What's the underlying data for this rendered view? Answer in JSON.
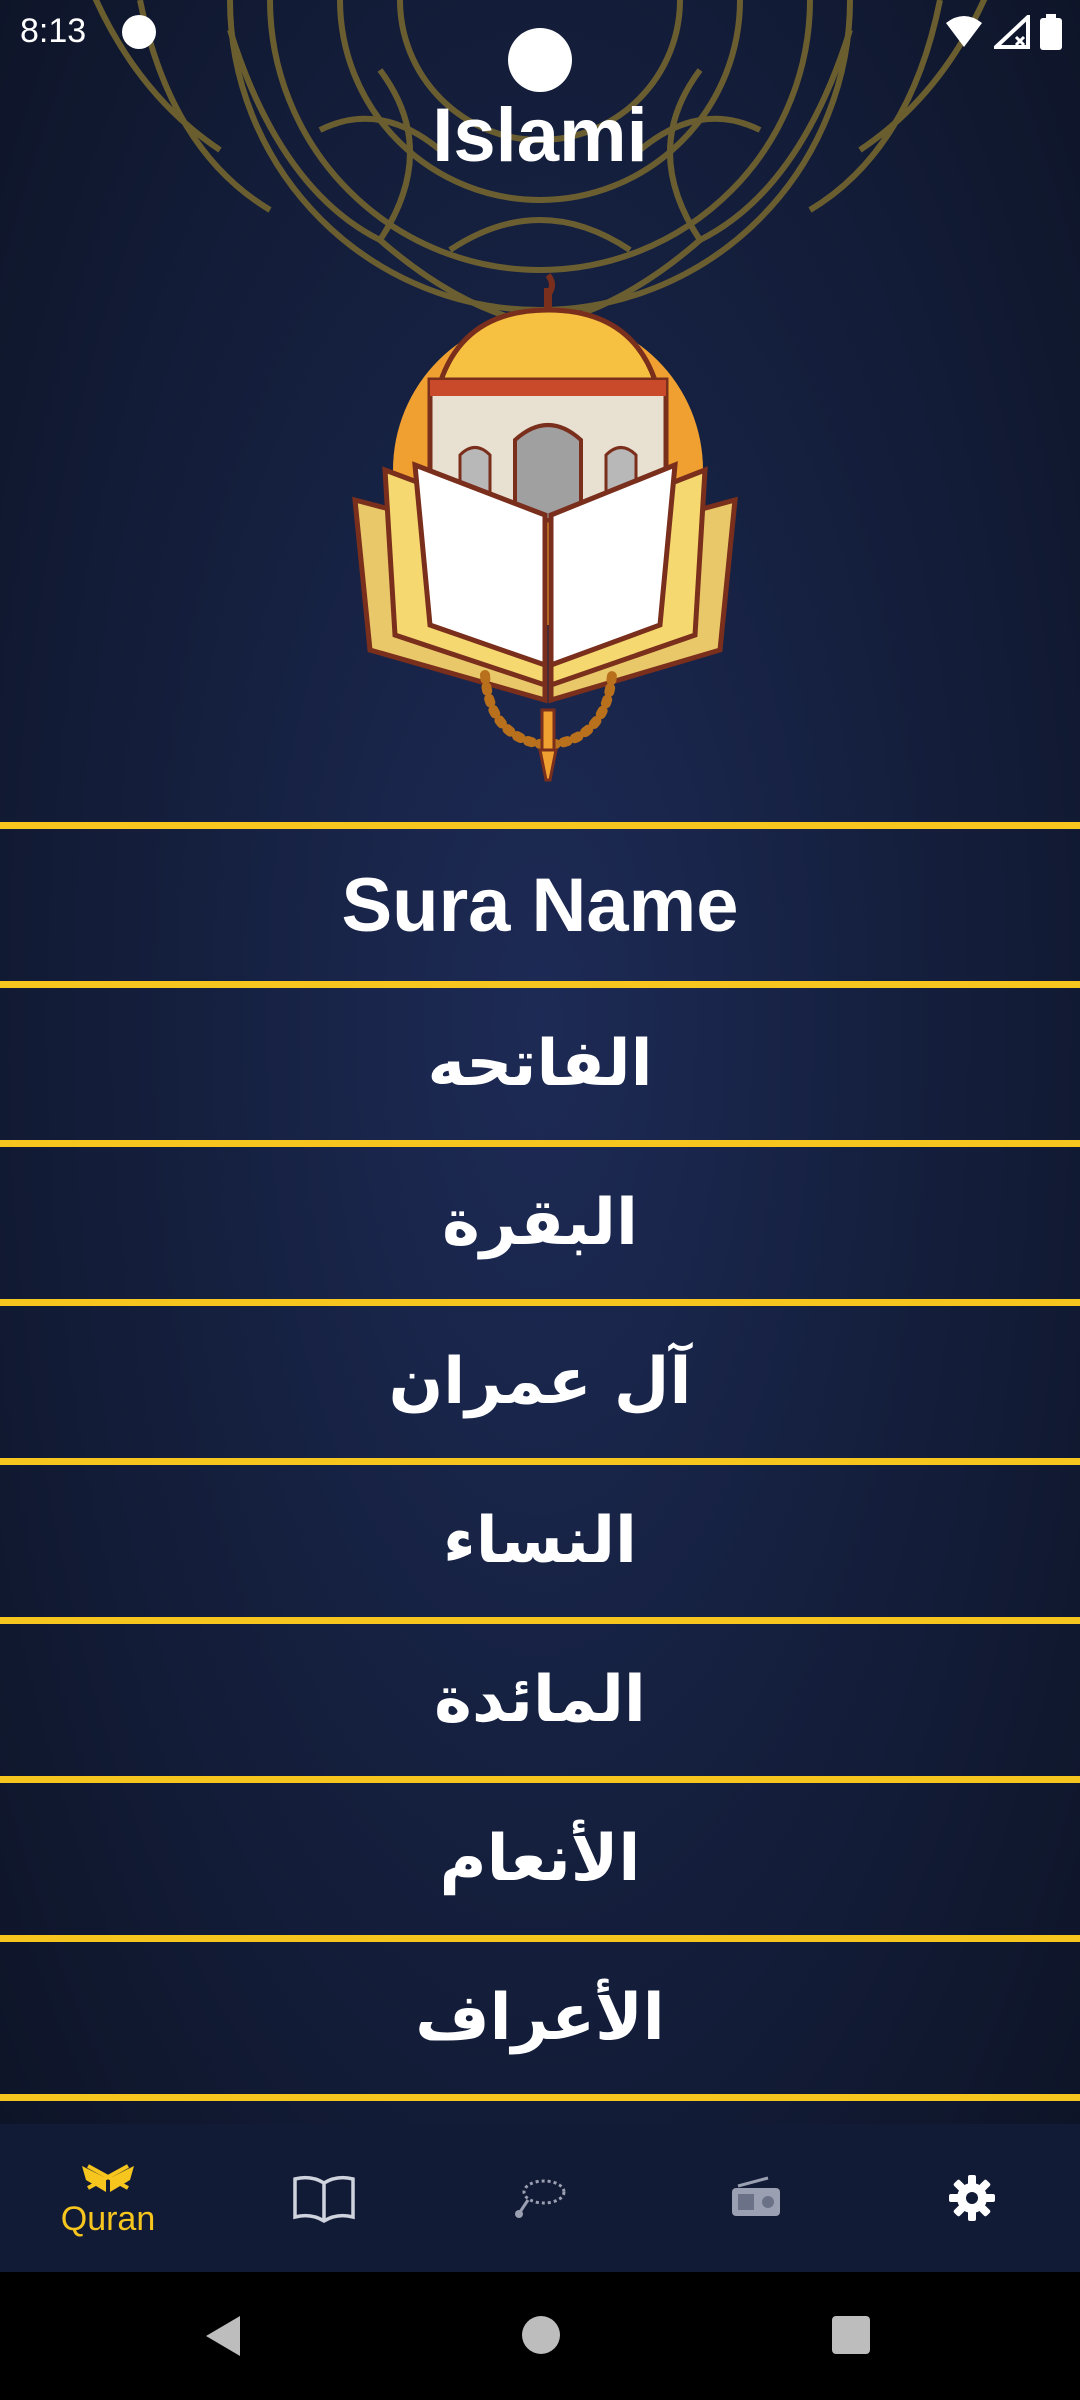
{
  "status_bar": {
    "time": "8:13"
  },
  "app": {
    "title": "Islami"
  },
  "sura_list": {
    "header": "Sura Name",
    "items": [
      "الفاتحه",
      "البقرة",
      "آل عمران",
      "النساء",
      "المائدة",
      "الأنعام",
      "الأعراف"
    ]
  },
  "bottom_nav": {
    "items": [
      {
        "label": "Quran",
        "icon": "quran-icon",
        "selected": true
      },
      {
        "label": "",
        "icon": "book-icon",
        "selected": false
      },
      {
        "label": "",
        "icon": "sebha-icon",
        "selected": false
      },
      {
        "label": "",
        "icon": "radio-icon",
        "selected": false
      },
      {
        "label": "",
        "icon": "gear-icon",
        "selected": false
      }
    ]
  },
  "colors": {
    "accent": "#f6c51e",
    "background": "#15203f",
    "nav_background": "#121b35"
  }
}
